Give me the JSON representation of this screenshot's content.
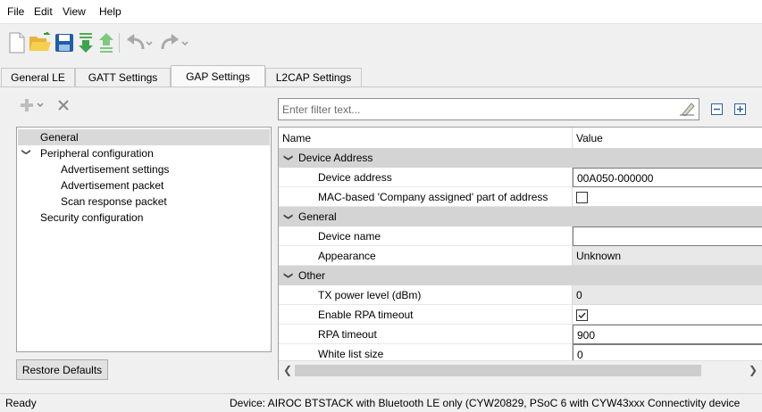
{
  "menu": [
    "File",
    "Edit",
    "View",
    "Help"
  ],
  "toolbar": {
    "icons": [
      "new-file-icon",
      "open-folder-icon",
      "save-icon",
      "download-icon",
      "upload-icon",
      "undo-icon",
      "redo-icon"
    ]
  },
  "tabs": [
    {
      "label": "General LE",
      "active": false
    },
    {
      "label": "GATT Settings",
      "active": false
    },
    {
      "label": "GAP Settings",
      "active": true
    },
    {
      "label": "L2CAP Settings",
      "active": false
    }
  ],
  "tree": {
    "items": [
      {
        "label": "General",
        "selected": true
      },
      {
        "label": "Peripheral configuration",
        "expanded": true
      },
      {
        "label": "Advertisement settings"
      },
      {
        "label": "Advertisement packet"
      },
      {
        "label": "Scan response packet"
      },
      {
        "label": "Security configuration"
      }
    ]
  },
  "restore_button": "Restore Defaults",
  "filter": {
    "placeholder": "Enter filter text..."
  },
  "grid": {
    "headers": {
      "name": "Name",
      "value": "Value"
    },
    "categories": [
      {
        "label": "Device Address",
        "rows": [
          {
            "name": "Device address",
            "value": "00A050-000000",
            "kind": "text"
          },
          {
            "name": "MAC-based 'Company assigned' part of address",
            "value": "",
            "kind": "checkbox",
            "checked": false
          }
        ]
      },
      {
        "label": "General",
        "rows": [
          {
            "name": "Device name",
            "value": "",
            "kind": "text"
          },
          {
            "name": "Appearance",
            "value": "Unknown",
            "kind": "readonly"
          }
        ]
      },
      {
        "label": "Other",
        "rows": [
          {
            "name": "TX power level (dBm)",
            "value": "0",
            "kind": "readonly"
          },
          {
            "name": "Enable RPA timeout",
            "value": "",
            "kind": "checkbox",
            "checked": true
          },
          {
            "name": "RPA timeout",
            "value": "900",
            "kind": "text"
          },
          {
            "name": "White list size",
            "value": "0",
            "kind": "text"
          }
        ]
      }
    ]
  },
  "status": {
    "left": "Ready",
    "right": "Device: AIROC BTSTACK with Bluetooth LE only (CYW20829, PSoC 6 with CYW43xxx Connectivity device"
  }
}
